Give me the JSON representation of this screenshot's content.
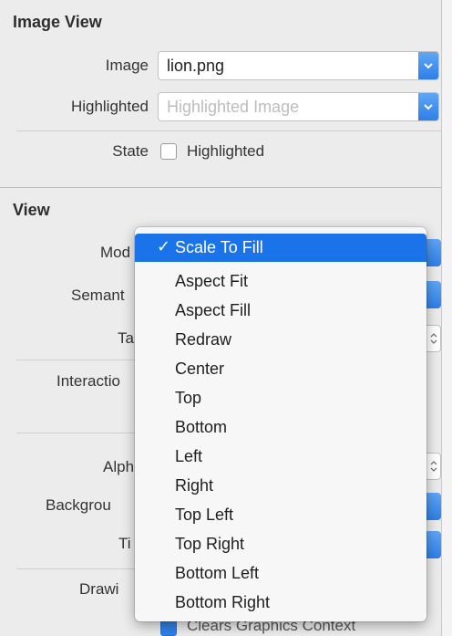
{
  "image_view": {
    "title": "Image View",
    "image_label": "Image",
    "image_value": "lion.png",
    "highlighted_label": "Highlighted",
    "highlighted_placeholder": "Highlighted Image",
    "state_label": "State",
    "state_checkbox_label": "Highlighted"
  },
  "view": {
    "title": "View",
    "mode_label": "Mod",
    "semantic_label": "Semant",
    "tag_label": "Ta",
    "interaction_label": "Interactio",
    "alpha_label": "Alph",
    "background_label": "Backgrou",
    "tint_label": "Ti",
    "drawing_label": "Drawi",
    "clears_label": "Clears Graphics Context"
  },
  "mode_menu": {
    "selected": "Scale To Fill",
    "items": [
      "Scale To Fill",
      "Aspect Fit",
      "Aspect Fill",
      "Redraw",
      "Center",
      "Top",
      "Bottom",
      "Left",
      "Right",
      "Top Left",
      "Top Right",
      "Bottom Left",
      "Bottom Right"
    ]
  },
  "colors": {
    "accent": "#1a73e8",
    "panel": "#ececec"
  }
}
